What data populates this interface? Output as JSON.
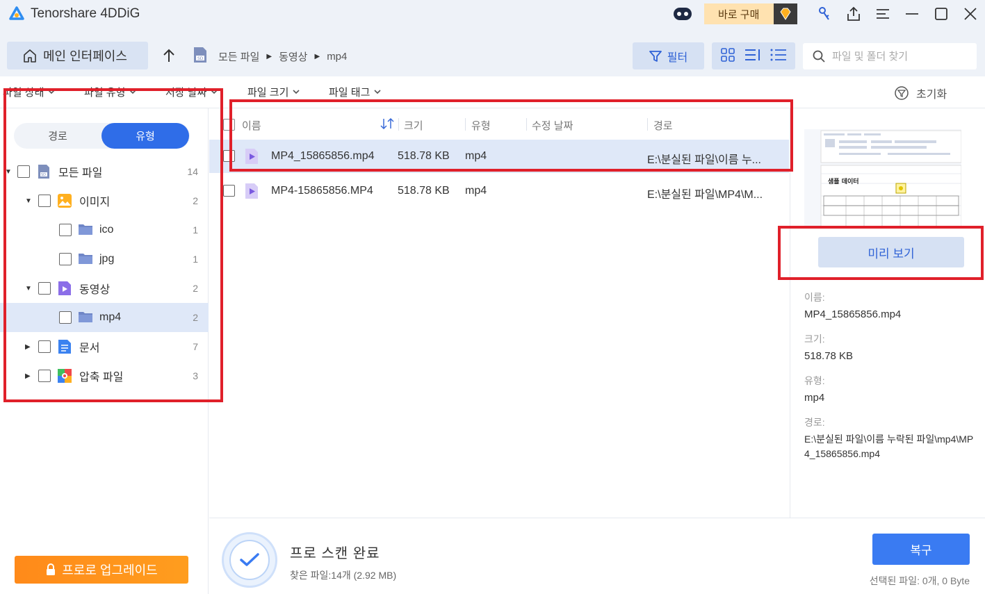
{
  "app": {
    "title": "Tenorshare 4DDiG",
    "buy_label": "바로 구매"
  },
  "toolbar": {
    "home_label": "메인 인터페이스",
    "breadcrumb": [
      "모든 파일",
      "동영상",
      "mp4"
    ],
    "filter_label": "필터",
    "search_placeholder": "파일 및 폴더 찾기"
  },
  "filters": {
    "items": [
      "파일 상태",
      "파일 유형",
      "저장 날짜",
      "파일 크기",
      "파일 태그"
    ],
    "reset_label": "초기화"
  },
  "sidebar": {
    "toggle": {
      "left": "경로",
      "right": "유형",
      "active": "유형"
    },
    "tree": [
      {
        "label": "모든 파일",
        "count": "14",
        "icon": "sd-card-icon",
        "expanded": true
      },
      {
        "label": "이미지",
        "count": "2",
        "icon": "image-icon",
        "expanded": true
      },
      {
        "label": "ico",
        "count": "1",
        "icon": "folder-icon"
      },
      {
        "label": "jpg",
        "count": "1",
        "icon": "folder-icon"
      },
      {
        "label": "동영상",
        "count": "2",
        "icon": "video-icon",
        "expanded": true
      },
      {
        "label": "mp4",
        "count": "2",
        "icon": "folder-icon",
        "selected": true
      },
      {
        "label": "문서",
        "count": "7",
        "icon": "document-icon",
        "expanded": false
      },
      {
        "label": "압축 파일",
        "count": "3",
        "icon": "archive-icon",
        "expanded": false
      }
    ],
    "upgrade_label": "프로로 업그레이드"
  },
  "filelist": {
    "columns": [
      "이름",
      "크기",
      "유형",
      "수정 날짜",
      "경로"
    ],
    "rows": [
      {
        "name": "MP4_15865856.mp4",
        "size": "518.78 KB",
        "type": "mp4",
        "date": "",
        "path": "E:\\분실된 파일\\이름 누...",
        "selected": true
      },
      {
        "name": "MP4-15865856.MP4",
        "size": "518.78 KB",
        "type": "mp4",
        "date": "",
        "path": "E:\\분실된 파일\\MP4\\M...",
        "selected": false
      }
    ]
  },
  "preview": {
    "button_label": "미리 보기",
    "thumb_text": "샘플 데이터",
    "name_label": "이름:",
    "name_value": "MP4_15865856.mp4",
    "size_label": "크기:",
    "size_value": "518.78 KB",
    "type_label": "유형:",
    "type_value": "mp4",
    "path_label": "경로:",
    "path_value": "E:\\분실된 파일\\이름 누락된 파일\\mp4\\MP4_15865856.mp4"
  },
  "status": {
    "title": "프로 스캔 완료",
    "found": "찾은 파일:14개 (2.92 MB)",
    "recover_label": "복구",
    "selected": "선택된 파일: 0개, 0 Byte"
  },
  "colors": {
    "accent": "#2f6de8",
    "highlight": "#e0202a",
    "upgrade": "#ff8a1a"
  }
}
